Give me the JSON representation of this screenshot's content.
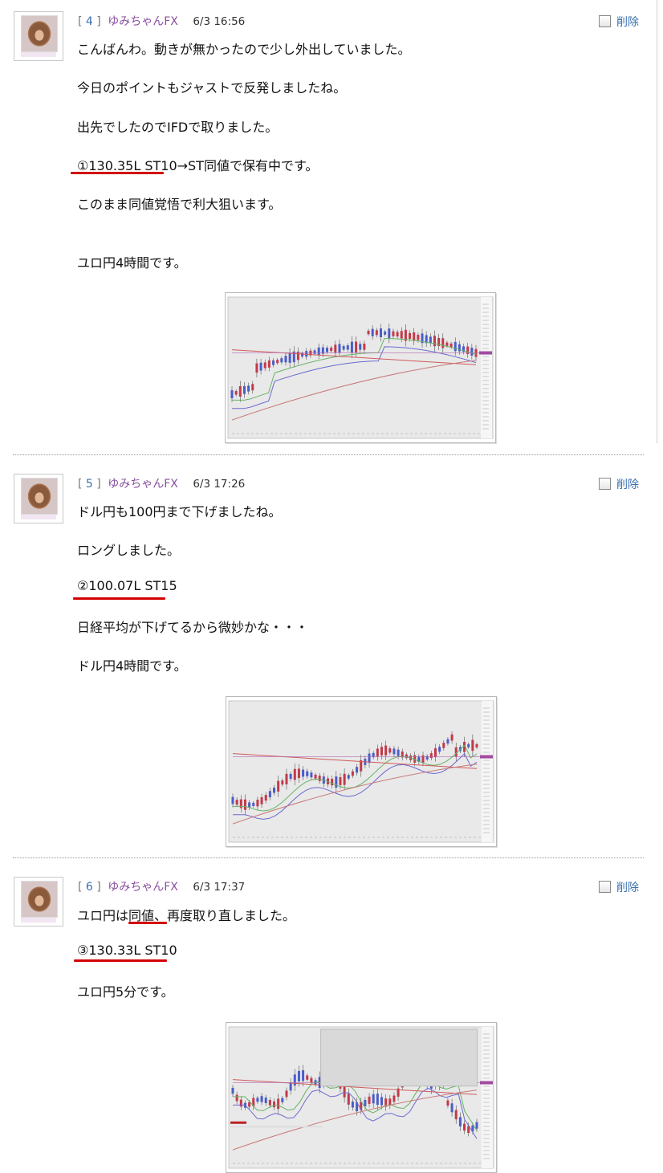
{
  "posts": [
    {
      "num": "4",
      "author": "ゆみちゃんFX",
      "date": "6/3 16:56",
      "delete_label": "削除",
      "lines": [
        "こんばんわ。動きが無かったので少し外出していました。",
        "今日のポイントもジャストで反発しましたね。",
        "出先でしたのでIFDで取りました。",
        "①130.35L  ST10→ST同値で保有中です。",
        "このまま同値覚悟で利大狙います。",
        "ユロ円4時間です。"
      ]
    },
    {
      "num": "5",
      "author": "ゆみちゃんFX",
      "date": "6/3 17:26",
      "delete_label": "削除",
      "lines": [
        "ドル円も100円まで下げましたね。",
        "ロングしました。",
        "②100.07L  ST15",
        "日経平均が下げてるから微妙かな・・・",
        "ドル円4時間です。"
      ]
    },
    {
      "num": "6",
      "author": "ゆみちゃんFX",
      "date": "6/3 17:37",
      "delete_label": "削除",
      "lines": [
        "ユロ円は同値、再度取り直しました。",
        "③130.33L  ST10",
        "ユロ円5分です。"
      ]
    }
  ],
  "colors": {
    "name": "#8a4fa0",
    "number": "#3a6fb0",
    "delete_link": "#3a6fb0",
    "underline": "#d40000",
    "candle_up": "#4a5dc8",
    "candle_down": "#c23a4a"
  },
  "icons": {
    "checkbox": "checkbox-icon",
    "avatar": "avatar-icon"
  }
}
